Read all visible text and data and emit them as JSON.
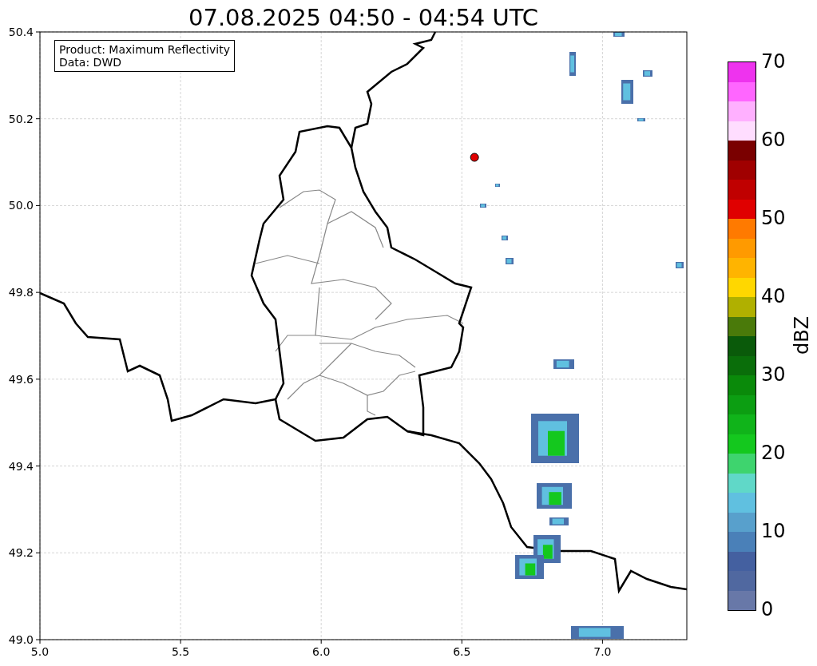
{
  "title": "07.08.2025 04:50 - 04:54 UTC",
  "map": {
    "legend": [
      "Product: Maximum Reflectivity",
      "Data: DWD"
    ],
    "x_ticks": [
      "5.0",
      "5.5",
      "6.0",
      "6.5",
      "7.0"
    ],
    "y_ticks": [
      "50.4",
      "50.2",
      "50.0",
      "49.8",
      "49.6",
      "49.4",
      "49.2",
      "49.0"
    ]
  },
  "colorbar": {
    "label": "dBZ",
    "ticks": [
      "70",
      "60",
      "50",
      "40",
      "30",
      "20",
      "10",
      "0"
    ],
    "segments": [
      {
        "color": "#ee33ee"
      },
      {
        "color": "#ff66ff"
      },
      {
        "color": "#ffb0ff"
      },
      {
        "color": "#ffddff"
      },
      {
        "color": "#7a0000"
      },
      {
        "color": "#a00000"
      },
      {
        "color": "#c00000"
      },
      {
        "color": "#e00000"
      },
      {
        "color": "#ff7a00"
      },
      {
        "color": "#ff9a00"
      },
      {
        "color": "#ffb400"
      },
      {
        "color": "#ffd700"
      },
      {
        "color": "#b0b000"
      },
      {
        "color": "#4a7a0a"
      },
      {
        "color": "#0a5a0a"
      },
      {
        "color": "#0a6e0a"
      },
      {
        "color": "#0a8a0a"
      },
      {
        "color": "#0c9e12"
      },
      {
        "color": "#10b41a"
      },
      {
        "color": "#14c81e"
      },
      {
        "color": "#3ed46e"
      },
      {
        "color": "#60d8c8"
      },
      {
        "color": "#60c0e0"
      },
      {
        "color": "#58a0cc"
      },
      {
        "color": "#4a80b8"
      },
      {
        "color": "#4460a0"
      },
      {
        "color": "#5068a0"
      },
      {
        "color": "#6878a8"
      }
    ]
  }
}
